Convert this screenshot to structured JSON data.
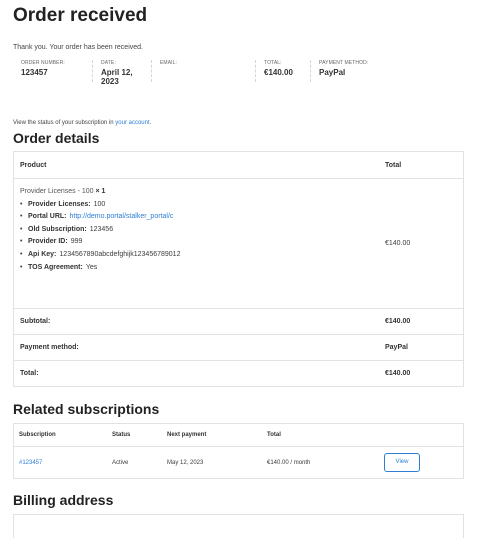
{
  "page": {
    "title": "Order received",
    "thank_you": "Thank you. Your order has been received."
  },
  "overview": [
    {
      "label": "Order number:",
      "value": "123457"
    },
    {
      "label": "Date:",
      "value": "April 12, 2023"
    },
    {
      "label": "Email:",
      "value": ""
    },
    {
      "label": "Total:",
      "value": "€140.00"
    },
    {
      "label": "Payment method:",
      "value": "PayPal"
    }
  ],
  "status_line": {
    "text": "View the status of your subscription in ",
    "link": "your account",
    "end": "."
  },
  "order_details": {
    "heading": "Order details",
    "col_product": "Product",
    "col_total": "Total",
    "product_name": "Provider Licenses - 100",
    "product_qty": "× 1",
    "product_total": "€140.00",
    "meta": [
      {
        "key": "Provider Licenses:",
        "value": "100",
        "is_link": false
      },
      {
        "key": "Portal URL:",
        "value": "http://demo.portal/stalker_portal/c",
        "is_link": true
      },
      {
        "key": "Old Subscription:",
        "value": "123456",
        "is_link": false
      },
      {
        "key": "Provider ID:",
        "value": "999",
        "is_link": false
      },
      {
        "key": "Api Key:",
        "value": "1234567890abcdefghijk123456789012",
        "is_link": false
      },
      {
        "key": "TOS Agreement:",
        "value": "Yes",
        "is_link": false
      }
    ],
    "subtotal_label": "Subtotal:",
    "subtotal_value": "€140.00",
    "payment_label": "Payment method:",
    "payment_value": "PayPal",
    "total_label": "Total:",
    "total_value": "€140.00"
  },
  "related": {
    "heading": "Related subscriptions",
    "headers": [
      "Subscription",
      "Status",
      "Next payment",
      "Total"
    ],
    "row": {
      "subscription": "#123457",
      "status": "Active",
      "next_payment": "May 12, 2023",
      "total": "€140.00 / month",
      "action": "View"
    }
  },
  "billing": {
    "heading": "Billing address"
  },
  "colors": {
    "link": "#2d7fd6",
    "border": "#e2e2e2"
  }
}
